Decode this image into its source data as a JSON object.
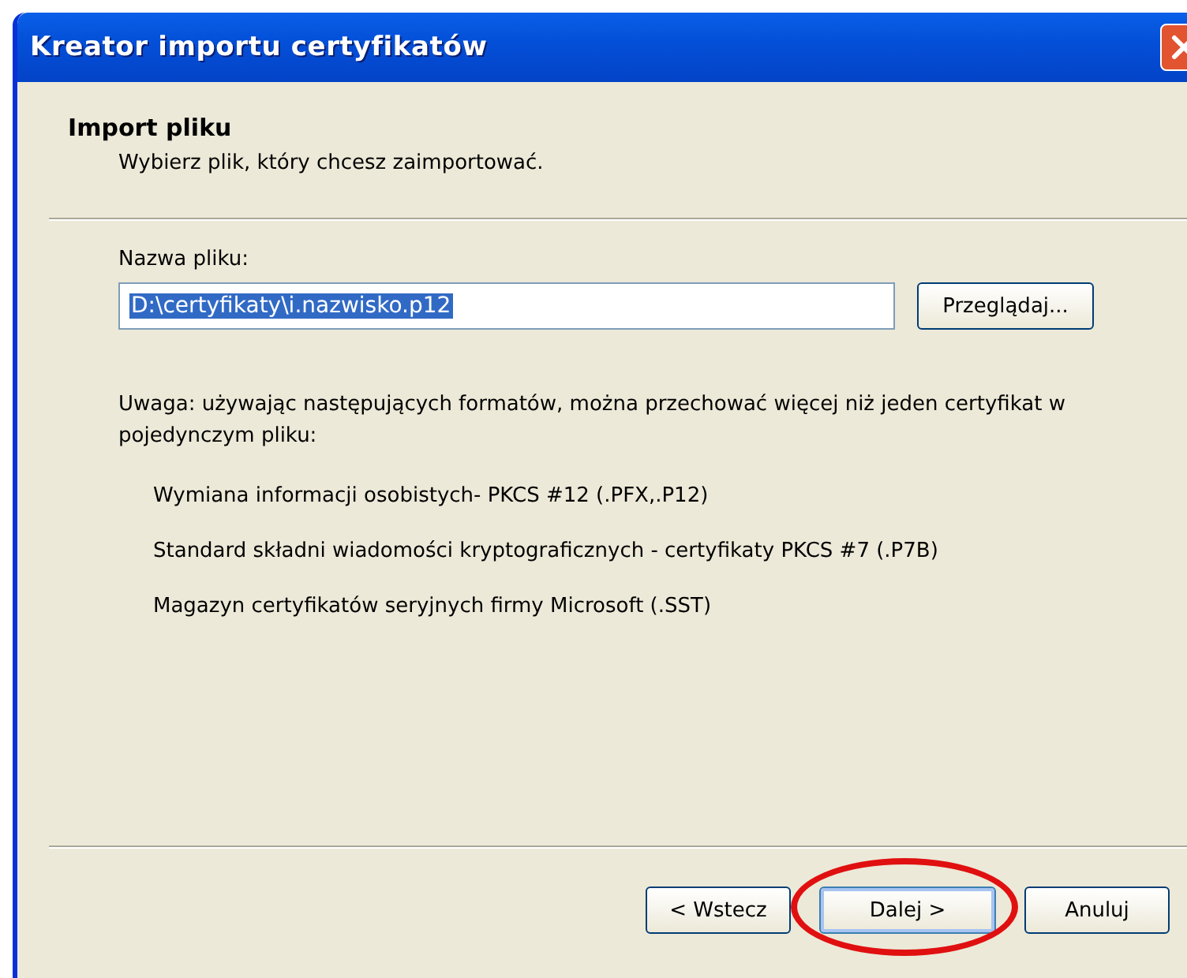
{
  "window": {
    "title": "Kreator importu certyfikatów"
  },
  "header": {
    "title": "Import pliku",
    "subtitle": "Wybierz plik, który chcesz zaimportować."
  },
  "file_field": {
    "label": "Nazwa pliku:",
    "value": "D:\\certyfikaty\\i.nazwisko.p12",
    "text_selected": true,
    "browse_button": "Przeglądaj..."
  },
  "note": "Uwaga: używając następujących formatów, można przechować więcej niż jeden certyfikat w pojedynczym pliku:",
  "formats": [
    "Wymiana informacji osobistych- PKCS #12 (.PFX,.P12)",
    "Standard składni wiadomości kryptograficznych - certyfikaty PKCS #7 (.P7B)",
    "Magazyn certyfikatów seryjnych firmy Microsoft (.SST)"
  ],
  "buttons": [
    {
      "label": "< Wstecz",
      "default": false,
      "circled": false
    },
    {
      "label": "Dalej >",
      "default": true,
      "circled": true
    },
    {
      "label": "Anuluj",
      "default": false,
      "circled": false
    }
  ]
}
